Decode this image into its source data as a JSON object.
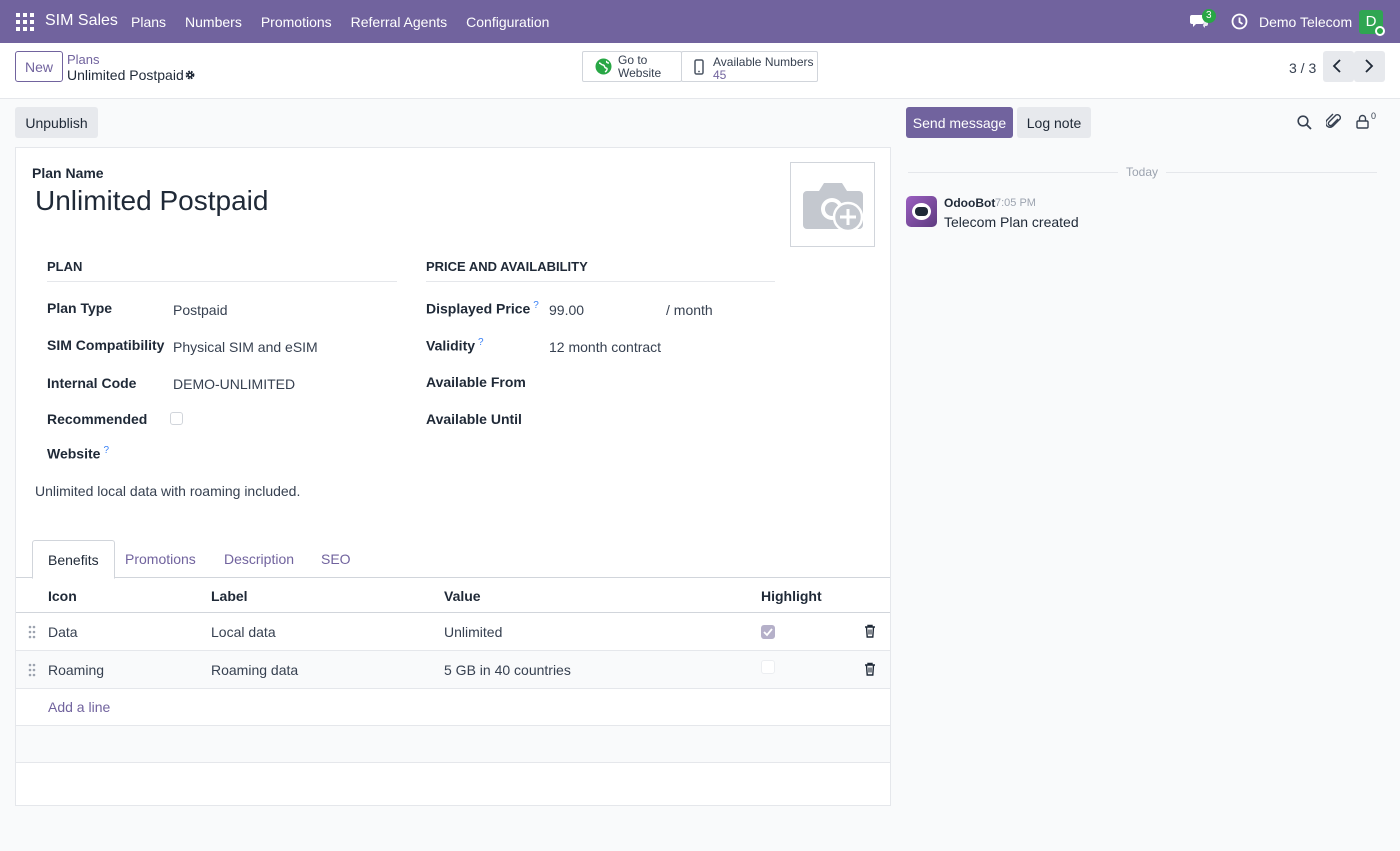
{
  "navbar": {
    "brand": "SIM Sales",
    "menu": [
      "Plans",
      "Numbers",
      "Promotions",
      "Referral Agents",
      "Configuration"
    ],
    "chat_badge": "3",
    "company": "Demo Telecom",
    "avatar_initial": "D"
  },
  "control": {
    "new_label": "New",
    "breadcrumb_parent": "Plans",
    "breadcrumb_current": "Unlimited Postpaid",
    "go_to_website": "Go to Website",
    "available_numbers_label": "Available Numbers",
    "available_numbers_value": "45",
    "pager": "3 / 3"
  },
  "form": {
    "unpublish_label": "Unpublish",
    "plan_name_label": "Plan Name",
    "plan_name": "Unlimited Postpaid",
    "group_plan": "PLAN",
    "group_price": "PRICE AND AVAILABILITY",
    "fields": {
      "plan_type_label": "Plan Type",
      "plan_type": "Postpaid",
      "sim_label": "SIM Compatibility",
      "sim": "Physical SIM and eSIM",
      "internal_code_label": "Internal Code",
      "internal_code": "DEMO-UNLIMITED",
      "recommended_label": "Recommended",
      "website_label": "Website",
      "displayed_price_label": "Displayed Price",
      "displayed_price": "99.00",
      "price_unit": "/ month",
      "validity_label": "Validity",
      "validity": "12 month contract",
      "available_from_label": "Available From",
      "available_until_label": "Available Until"
    },
    "help_mark": "?",
    "description": "Unlimited local data with roaming included.",
    "tabs": [
      "Benefits",
      "Promotions",
      "Description",
      "SEO"
    ],
    "table": {
      "headers": [
        "Icon",
        "Label",
        "Value",
        "Highlight"
      ],
      "rows": [
        {
          "icon": "Data",
          "label": "Local data",
          "value": "Unlimited",
          "highlight": true
        },
        {
          "icon": "Roaming",
          "label": "Roaming data",
          "value": "5 GB in 40 countries",
          "highlight": false
        }
      ],
      "add_line": "Add a line"
    }
  },
  "chatter": {
    "send_message": "Send message",
    "log_note": "Log note",
    "follower_count": "0",
    "today": "Today",
    "message_author": "OdooBot",
    "message_time": "7:05 PM",
    "message_body": "Telecom Plan created"
  },
  "colors": {
    "brand": "#71639e",
    "success": "#28a745",
    "link": "#71639e"
  }
}
